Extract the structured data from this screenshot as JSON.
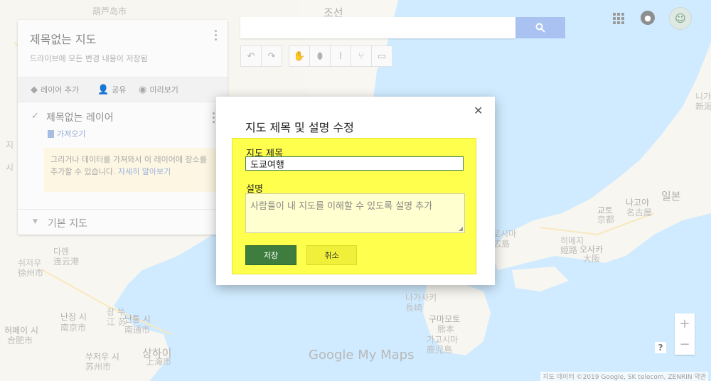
{
  "map": {
    "labels": [
      {
        "text": "조선",
        "cls": "big dark"
      },
      {
        "text": "일본",
        "cls": "big dark"
      },
      {
        "text": "나고야",
        "cls": "dark"
      },
      {
        "text": "名古屋",
        "cls": ""
      },
      {
        "text": "교토",
        "cls": "dark"
      },
      {
        "text": "京都",
        "cls": ""
      },
      {
        "text": "오사카",
        "cls": "dark"
      },
      {
        "text": "大阪",
        "cls": ""
      },
      {
        "text": "로시마",
        "cls": ""
      },
      {
        "text": "広島",
        "cls": ""
      },
      {
        "text": "히메지",
        "cls": ""
      },
      {
        "text": "姫路",
        "cls": ""
      },
      {
        "text": "구마모토",
        "cls": "dark"
      },
      {
        "text": "熊本",
        "cls": ""
      },
      {
        "text": "가고시마",
        "cls": ""
      },
      {
        "text": "鹿児島",
        "cls": ""
      },
      {
        "text": "나가사키",
        "cls": ""
      },
      {
        "text": "長崎",
        "cls": ""
      },
      {
        "text": "상하이",
        "cls": "big dark"
      },
      {
        "text": "上海市",
        "cls": ""
      },
      {
        "text": "난징 시",
        "cls": "dark"
      },
      {
        "text": "南京市",
        "cls": ""
      },
      {
        "text": "난퉁 시",
        "cls": "dark"
      },
      {
        "text": "南通市",
        "cls": ""
      },
      {
        "text": "허페이 시",
        "cls": "dark"
      },
      {
        "text": "合肥市",
        "cls": ""
      },
      {
        "text": "쑤저우 시",
        "cls": "dark"
      },
      {
        "text": "苏州市",
        "cls": ""
      },
      {
        "text": "장 쑤",
        "cls": ""
      },
      {
        "text": "江 苏",
        "cls": ""
      },
      {
        "text": "쉬저우",
        "cls": ""
      },
      {
        "text": "徐州市",
        "cls": ""
      },
      {
        "text": "다롄",
        "cls": ""
      },
      {
        "text": "连云港",
        "cls": ""
      },
      {
        "text": "니가",
        "cls": ""
      },
      {
        "text": "新潟",
        "cls": ""
      },
      {
        "text": "葫芦岛市",
        "cls": ""
      },
      {
        "text": "지",
        "cls": ""
      },
      {
        "text": "시",
        "cls": ""
      }
    ]
  },
  "panel": {
    "title": "제목없는 지도",
    "subtitle": "드라이브에 모든 변경 내용이 저장됨",
    "actions": {
      "add_layer": "레이어 추가",
      "share": "공유",
      "preview": "미리보기"
    },
    "layer_title": "제목없는 레이어",
    "import_label": "가져오기",
    "info_text": "그리거나 데이터를 가져와서 이 레이어에 장소를 추가할 수 있습니다.",
    "info_link": "자세히 알아보기",
    "base_map_label": "기본 지도"
  },
  "search": {
    "placeholder": ""
  },
  "toolbar": {
    "undo_icon": "undo-icon",
    "redo_icon": "redo-icon",
    "hand_icon": "hand-icon",
    "marker_icon": "marker-icon",
    "line_icon": "draw-line-icon",
    "directions_icon": "directions-icon",
    "ruler_icon": "ruler-icon"
  },
  "dialog": {
    "title": "지도 제목 및 설명 수정",
    "title_label": "지도 제목",
    "title_value": "도쿄여행",
    "desc_label": "설명",
    "desc_placeholder": "사람들이 내 지도를 이해할 수 있도록 설명 추가",
    "save_label": "저장",
    "cancel_label": "취소",
    "close_glyph": "✕",
    "highlight_color": "#ffff4d"
  },
  "footer": {
    "watermark_google": "Google",
    "watermark_mymaps": "My Maps",
    "copyright": "지도 데이터 ©2019 Google, SK telecom, ZENRIN   약관",
    "help": "?",
    "zoom_in": "+",
    "zoom_out": "−"
  }
}
